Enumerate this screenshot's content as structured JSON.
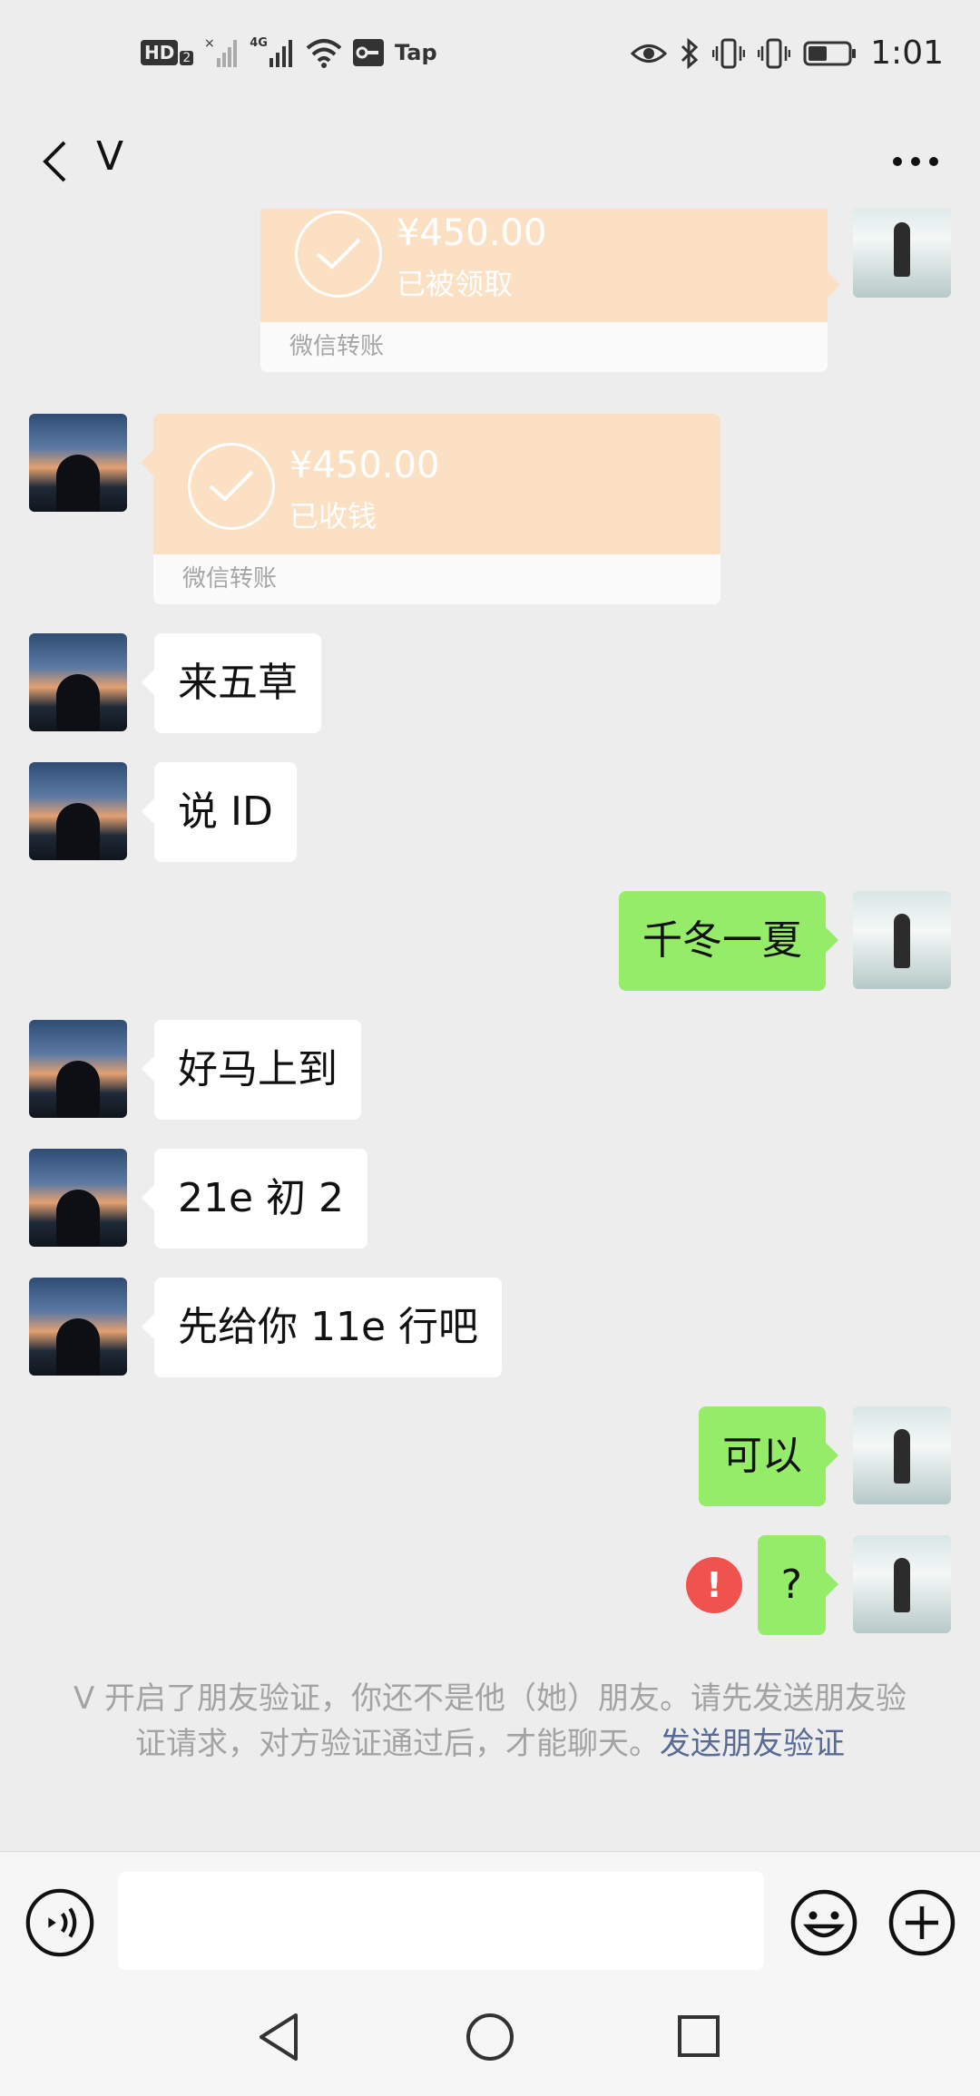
{
  "status_bar": {
    "hd_label": "HD",
    "hd_sub": "2",
    "network": "4G",
    "tap_label": "Tap",
    "time": "1:01"
  },
  "header": {
    "title": "V"
  },
  "transfers": [
    {
      "amount": "¥450.00",
      "status": "已被领取",
      "footer": "微信转账"
    },
    {
      "amount": "¥450.00",
      "status": "已收钱",
      "footer": "微信转账"
    }
  ],
  "messages": [
    {
      "text": "来五草"
    },
    {
      "text": "说 ID"
    },
    {
      "text": "千冬一夏"
    },
    {
      "text": "好马上到"
    },
    {
      "text": "21e 初 2"
    },
    {
      "text": "先给你 11e 行吧"
    },
    {
      "text": "可以"
    },
    {
      "text": "?"
    }
  ],
  "error_badge": "!",
  "system_message": {
    "text": "V 开启了朋友验证，你还不是他（她）朋友。请先发送朋友验证请求，对方验证通过后，才能聊天。",
    "link": "发送朋友验证"
  },
  "input": {
    "placeholder": ""
  },
  "colors": {
    "background": "#ededed",
    "self_bubble": "#95ec69",
    "other_bubble": "#ffffff",
    "transfer": "#fbe0c3",
    "link": "#576b95",
    "error": "#f0534e"
  }
}
